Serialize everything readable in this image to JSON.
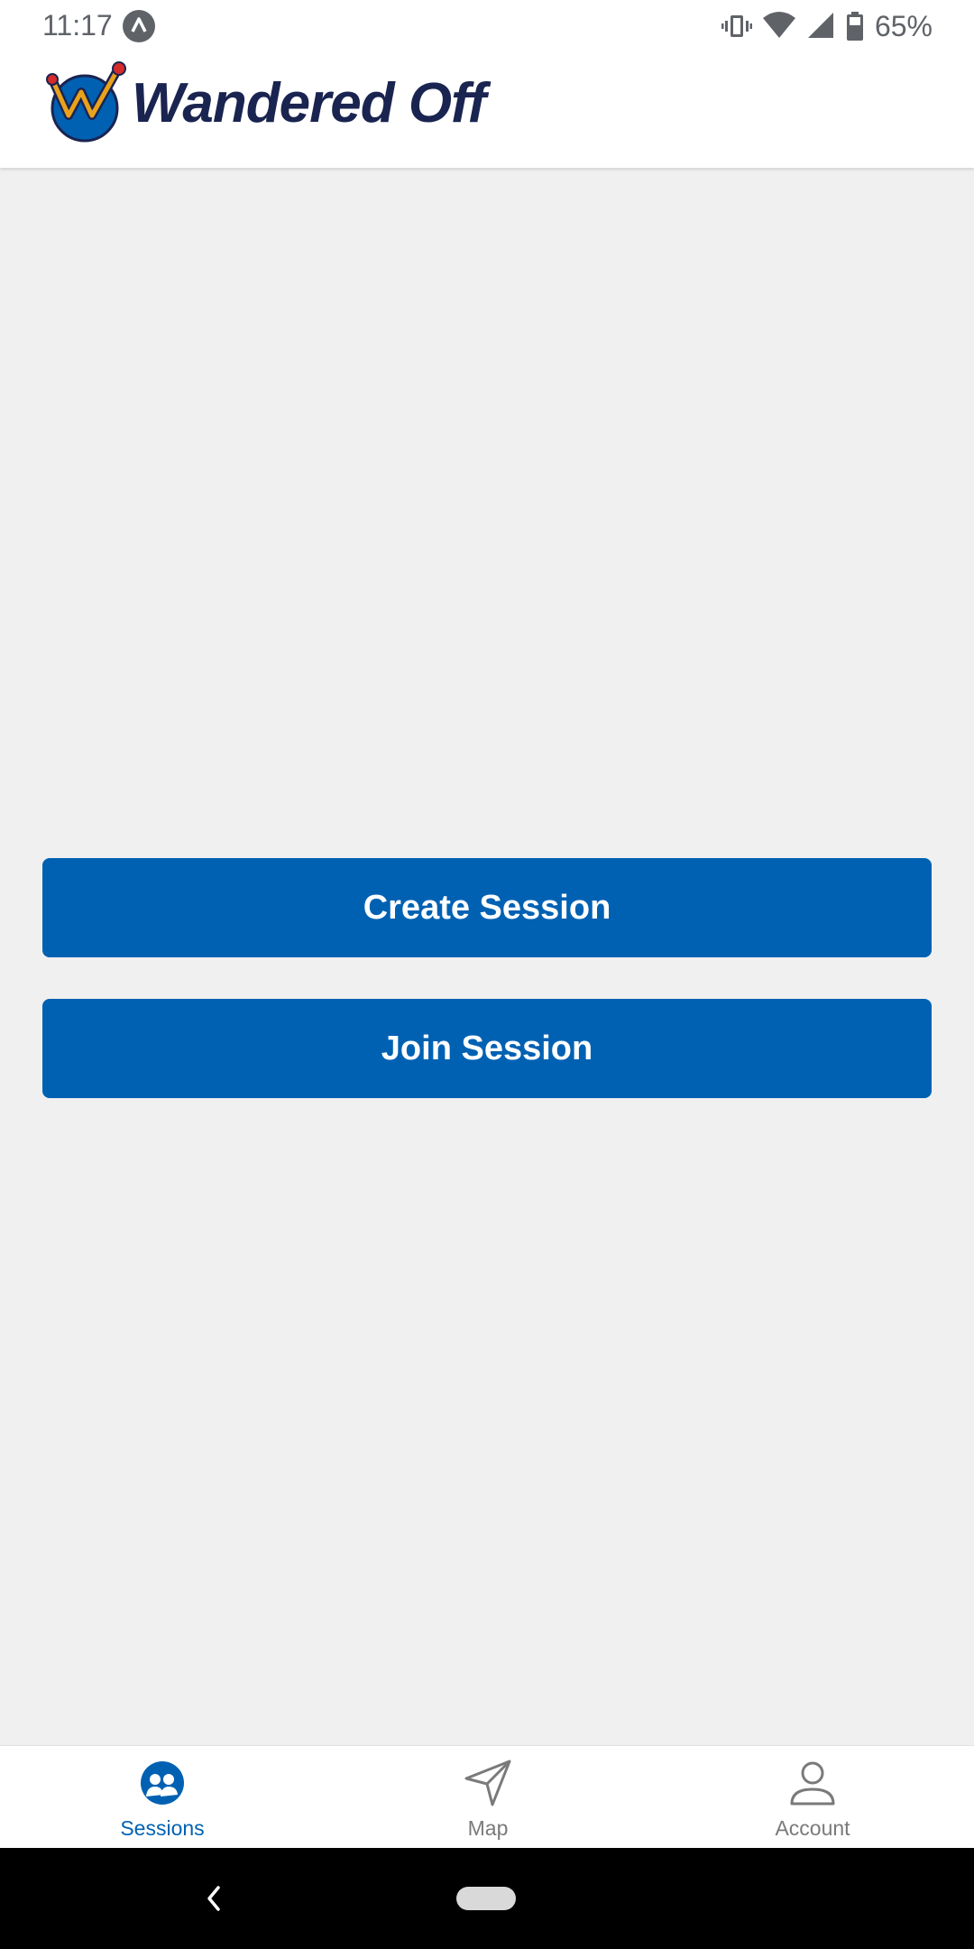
{
  "status_bar": {
    "time": "11:17",
    "battery": "65%",
    "icons": [
      "notification-a-icon",
      "vibrate-icon",
      "wifi-icon",
      "cell-signal-icon",
      "battery-icon"
    ]
  },
  "header": {
    "logo_text": "Wandered Off",
    "logo_icon": "wandered-off-logo-icon"
  },
  "main": {
    "create_session_label": "Create Session",
    "join_session_label": "Join Session"
  },
  "bottom_nav": {
    "items": [
      {
        "label": "Sessions",
        "icon": "sessions-icon",
        "active": true
      },
      {
        "label": "Map",
        "icon": "navigation-arrow-icon",
        "active": false
      },
      {
        "label": "Account",
        "icon": "person-icon",
        "active": false
      }
    ]
  },
  "colors": {
    "primary": "#0061b3",
    "background": "#f0f0f0",
    "inactive": "#7a7a7a",
    "logo_text": "#1a2450"
  }
}
